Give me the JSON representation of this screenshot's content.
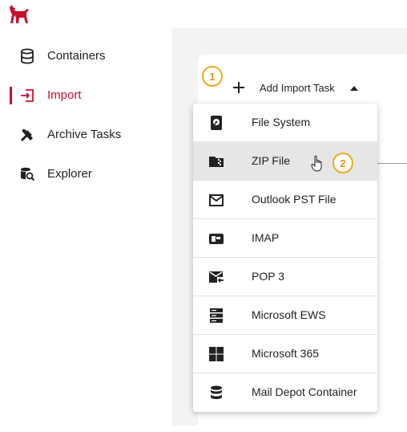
{
  "brand": {
    "logo_icon": "red-dog-logo-icon",
    "accent_color": "#c8102e"
  },
  "sidebar": {
    "items": [
      {
        "label": "Containers",
        "icon": "database-icon",
        "active": false
      },
      {
        "label": "Import",
        "icon": "import-icon",
        "active": true
      },
      {
        "label": "Archive Tasks",
        "icon": "tools-icon",
        "active": false
      },
      {
        "label": "Explorer",
        "icon": "database-search-icon",
        "active": false
      }
    ]
  },
  "main": {
    "add_task_label": "Add Import Task",
    "badges": {
      "first": "1",
      "second": "2"
    },
    "menu_items": [
      {
        "label": "File System",
        "icon": "hard-drive-icon"
      },
      {
        "label": "ZIP File",
        "icon": "zip-folder-icon",
        "hovered": true
      },
      {
        "label": "Outlook PST File",
        "icon": "envelope-icon"
      },
      {
        "label": "IMAP",
        "icon": "mailbox-icon"
      },
      {
        "label": "POP 3",
        "icon": "mail-receive-icon"
      },
      {
        "label": "Microsoft EWS",
        "icon": "server-icon"
      },
      {
        "label": "Microsoft 365",
        "icon": "windows-grid-icon"
      },
      {
        "label": "Mail Depot Container",
        "icon": "database-icon"
      }
    ]
  }
}
